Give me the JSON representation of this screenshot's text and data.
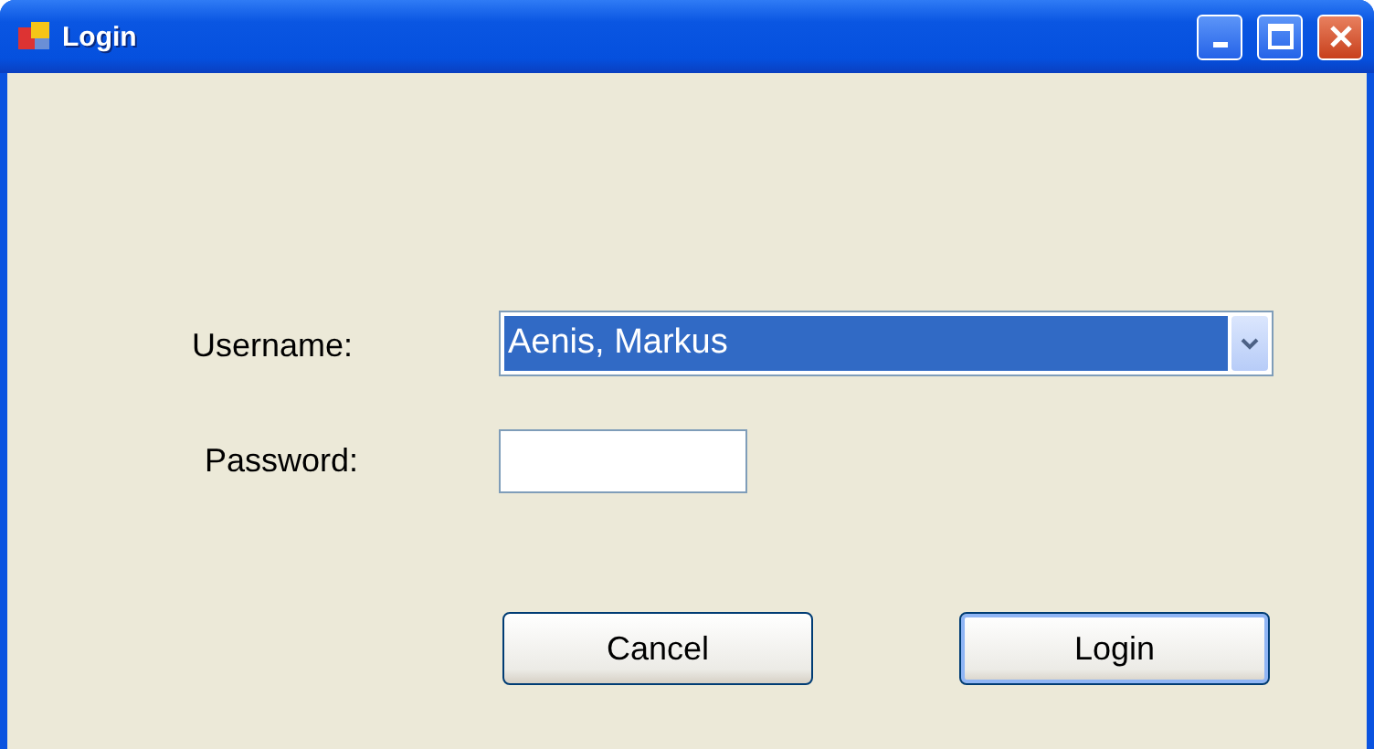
{
  "window": {
    "title": "Login"
  },
  "form": {
    "username_label": "Username:",
    "username_value": "Aenis, Markus",
    "password_label": "Password:"
  },
  "buttons": [
    {
      "label": "Cancel",
      "default": false
    },
    {
      "label": "Login",
      "default": true
    }
  ]
}
